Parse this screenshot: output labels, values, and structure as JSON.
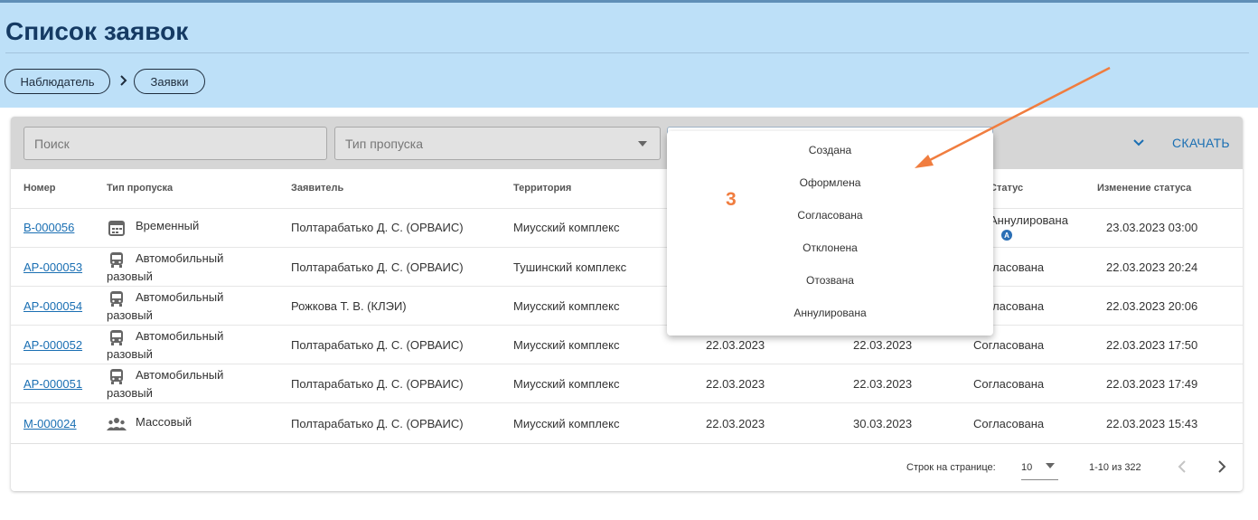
{
  "page": {
    "title": "Список заявок"
  },
  "breadcrumbs": [
    {
      "label": "Наблюдатель"
    },
    {
      "label": "Заявки"
    }
  ],
  "filters": {
    "search_placeholder": "Поиск",
    "type_placeholder": "Тип пропуска",
    "download_label": "СКАЧАТЬ"
  },
  "table": {
    "columns": [
      "Номер",
      "Тип пропуска",
      "Заявитель",
      "Территория",
      "Статус",
      "Изменение статуса"
    ],
    "rows": [
      {
        "number": "В-000056",
        "type_icon": "calendar-icon",
        "type_line1": "Временный",
        "type_line2": "",
        "applicant": "Полтарабатько Д. С. (ОРВАИС)",
        "territory": "Миусский комплекс",
        "date_from": "",
        "date_to": "",
        "status": "Аннулирована",
        "status_badge": "A",
        "changed": "23.03.2023 03:00"
      },
      {
        "number": "АР-000053",
        "type_icon": "bus-icon",
        "type_line1": "Автомобильный",
        "type_line2": "разовый",
        "applicant": "Полтарабатько Д. С. (ОРВАИС)",
        "territory": "Тушинский комплекс",
        "date_from": "",
        "date_to": "",
        "status": "Согласована",
        "status_badge": "",
        "changed": "22.03.2023 20:24"
      },
      {
        "number": "АР-000054",
        "type_icon": "bus-icon",
        "type_line1": "Автомобильный",
        "type_line2": "разовый",
        "applicant": "Рожкова Т. В. (КЛЭИ)",
        "territory": "Миусский комплекс",
        "date_from": "",
        "date_to": "",
        "status": "Согласована",
        "status_badge": "",
        "changed": "22.03.2023 20:06"
      },
      {
        "number": "АР-000052",
        "type_icon": "bus-icon",
        "type_line1": "Автомобильный",
        "type_line2": "разовый",
        "applicant": "Полтарабатько Д. С. (ОРВАИС)",
        "territory": "Миусский комплекс",
        "date_from": "22.03.2023",
        "date_to": "22.03.2023",
        "status": "Согласована",
        "status_badge": "",
        "changed": "22.03.2023 17:50"
      },
      {
        "number": "АР-000051",
        "type_icon": "bus-icon",
        "type_line1": "Автомобильный",
        "type_line2": "разовый",
        "applicant": "Полтарабатько Д. С. (ОРВАИС)",
        "territory": "Миусский комплекс",
        "date_from": "22.03.2023",
        "date_to": "22.03.2023",
        "status": "Согласована",
        "status_badge": "",
        "changed": "22.03.2023 17:49"
      },
      {
        "number": "М-000024",
        "type_icon": "group-icon",
        "type_line1": "Массовый",
        "type_line2": "",
        "applicant": "Полтарабатько Д. С. (ОРВАИС)",
        "territory": "Миусский комплекс",
        "date_from": "22.03.2023",
        "date_to": "30.03.2023",
        "status": "Согласована",
        "status_badge": "",
        "changed": "22.03.2023 15:43"
      }
    ]
  },
  "pagination": {
    "rows_per_page_label": "Строк на странице:",
    "rows_per_page_value": "10",
    "range": "1-10 из 322"
  },
  "status_dropdown": {
    "options": [
      "Создана",
      "Оформлена",
      "Согласована",
      "Отклонена",
      "Отозвана",
      "Аннулирована"
    ]
  },
  "annotation": {
    "label": "3",
    "color": "#f07d3f"
  },
  "colors": {
    "header_bg": "#bde0f8",
    "title": "#153a63",
    "link": "#1a6fb3",
    "toolbar_bg": "#d6d6d6"
  }
}
